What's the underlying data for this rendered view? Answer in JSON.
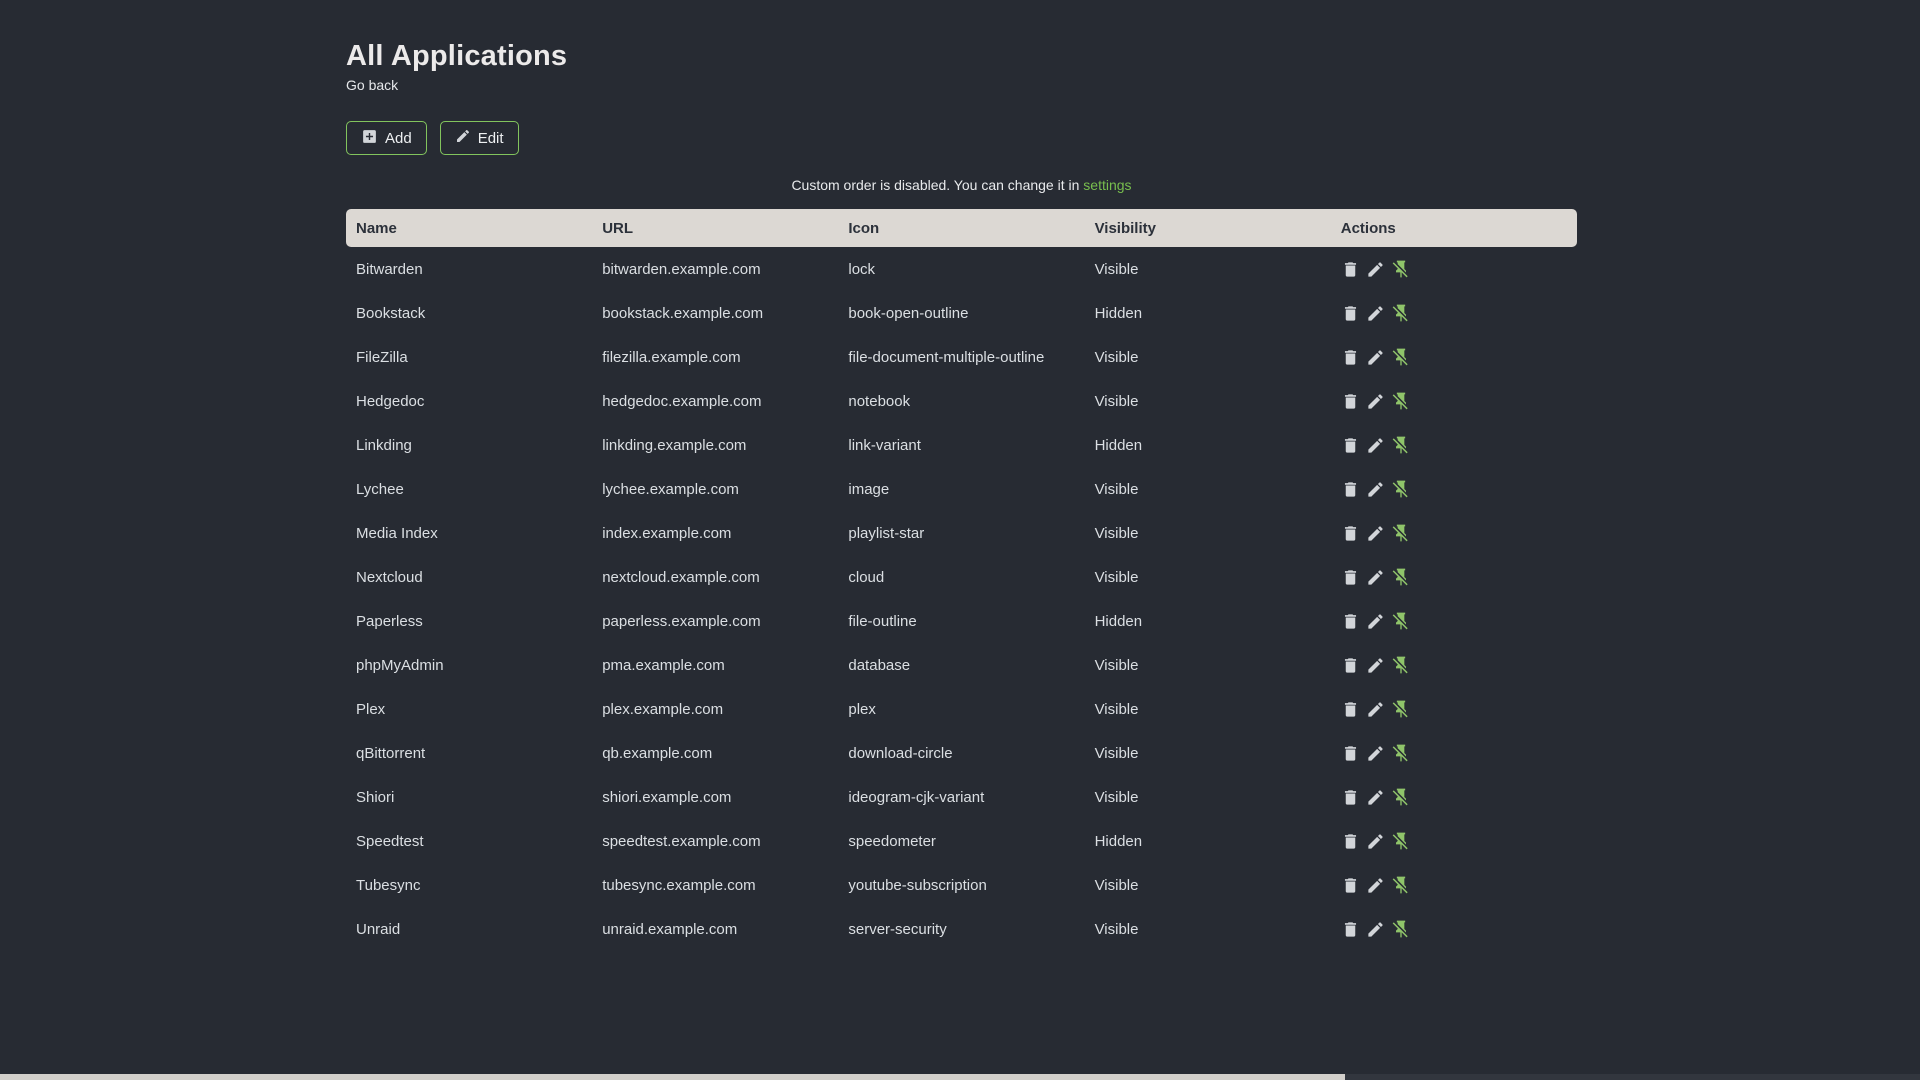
{
  "page": {
    "title": "All Applications",
    "back_link": "Go back",
    "notice_text": "Custom order is disabled. You can change it in ",
    "notice_link": "settings"
  },
  "toolbar": {
    "add_label": "Add",
    "add_icon": "plus-box-icon",
    "edit_label": "Edit",
    "edit_icon": "pencil-icon"
  },
  "table": {
    "columns": [
      "Name",
      "URL",
      "Icon",
      "Visibility",
      "Actions"
    ],
    "action_icons": [
      "trash-icon",
      "pencil-icon",
      "pin-off-icon"
    ],
    "rows": [
      {
        "name": "Bitwarden",
        "url": "bitwarden.example.com",
        "icon": "lock",
        "visibility": "Visible"
      },
      {
        "name": "Bookstack",
        "url": "bookstack.example.com",
        "icon": "book-open-outline",
        "visibility": "Hidden"
      },
      {
        "name": "FileZilla",
        "url": "filezilla.example.com",
        "icon": "file-document-multiple-outline",
        "visibility": "Visible"
      },
      {
        "name": "Hedgedoc",
        "url": "hedgedoc.example.com",
        "icon": "notebook",
        "visibility": "Visible"
      },
      {
        "name": "Linkding",
        "url": "linkding.example.com",
        "icon": "link-variant",
        "visibility": "Hidden"
      },
      {
        "name": "Lychee",
        "url": "lychee.example.com",
        "icon": "image",
        "visibility": "Visible"
      },
      {
        "name": "Media Index",
        "url": "index.example.com",
        "icon": "playlist-star",
        "visibility": "Visible"
      },
      {
        "name": "Nextcloud",
        "url": "nextcloud.example.com",
        "icon": "cloud",
        "visibility": "Visible"
      },
      {
        "name": "Paperless",
        "url": "paperless.example.com",
        "icon": "file-outline",
        "visibility": "Hidden"
      },
      {
        "name": "phpMyAdmin",
        "url": "pma.example.com",
        "icon": "database",
        "visibility": "Visible"
      },
      {
        "name": "Plex",
        "url": "plex.example.com",
        "icon": "plex",
        "visibility": "Visible"
      },
      {
        "name": "qBittorrent",
        "url": "qb.example.com",
        "icon": "download-circle",
        "visibility": "Visible"
      },
      {
        "name": "Shiori",
        "url": "shiori.example.com",
        "icon": "ideogram-cjk-variant",
        "visibility": "Visible"
      },
      {
        "name": "Speedtest",
        "url": "speedtest.example.com",
        "icon": "speedometer",
        "visibility": "Hidden"
      },
      {
        "name": "Tubesync",
        "url": "tubesync.example.com",
        "icon": "youtube-subscription",
        "visibility": "Visible"
      },
      {
        "name": "Unraid",
        "url": "unraid.example.com",
        "icon": "server-security",
        "visibility": "Visible"
      }
    ]
  },
  "colors": {
    "background": "#272b33",
    "accent_green": "#78be4e",
    "button_border_green": "#82c45d",
    "pin_icon_green": "#8fc46a",
    "table_header_bg": "#dcd8d3",
    "table_header_text": "#2c313a",
    "body_text": "#dbdfe3",
    "icon_gray": "#d2d5d9"
  }
}
